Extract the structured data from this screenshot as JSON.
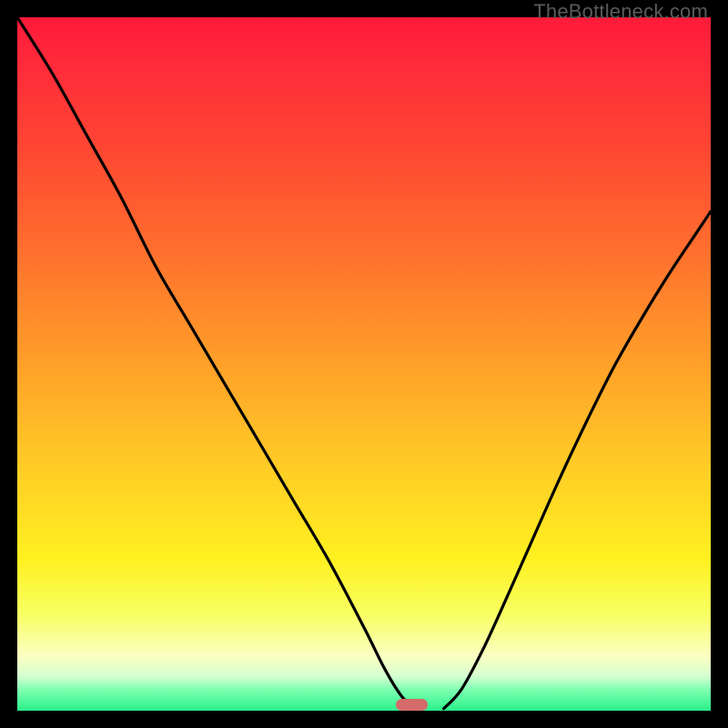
{
  "watermark": "TheBottleneck.com",
  "marker": {
    "x_frac": 0.569,
    "width_frac": 0.047,
    "color": "#d46a6a"
  },
  "chart_data": {
    "type": "line",
    "title": "",
    "xlabel": "",
    "ylabel": "",
    "xlim": [
      0,
      1
    ],
    "ylim": [
      0,
      1
    ],
    "grid": false,
    "series": [
      {
        "name": "left-branch",
        "x": [
          0.0,
          0.05,
          0.1,
          0.15,
          0.2,
          0.25,
          0.3,
          0.35,
          0.4,
          0.45,
          0.5,
          0.53,
          0.555,
          0.575
        ],
        "y": [
          1.0,
          0.92,
          0.83,
          0.74,
          0.64,
          0.555,
          0.47,
          0.385,
          0.3,
          0.215,
          0.12,
          0.06,
          0.02,
          0.003
        ]
      },
      {
        "name": "right-branch",
        "x": [
          0.615,
          0.64,
          0.67,
          0.7,
          0.74,
          0.78,
          0.82,
          0.86,
          0.9,
          0.94,
          0.98,
          1.0
        ],
        "y": [
          0.003,
          0.03,
          0.085,
          0.15,
          0.24,
          0.33,
          0.415,
          0.495,
          0.565,
          0.63,
          0.69,
          0.72
        ]
      }
    ],
    "background_gradient": {
      "direction": "top-to-bottom",
      "stops": [
        {
          "pos": 0.0,
          "color": "#ff1a3a"
        },
        {
          "pos": 0.32,
          "color": "#ff6a2e"
        },
        {
          "pos": 0.62,
          "color": "#ffc426"
        },
        {
          "pos": 0.86,
          "color": "#f7ff60"
        },
        {
          "pos": 1.0,
          "color": "#29f18a"
        }
      ]
    }
  }
}
